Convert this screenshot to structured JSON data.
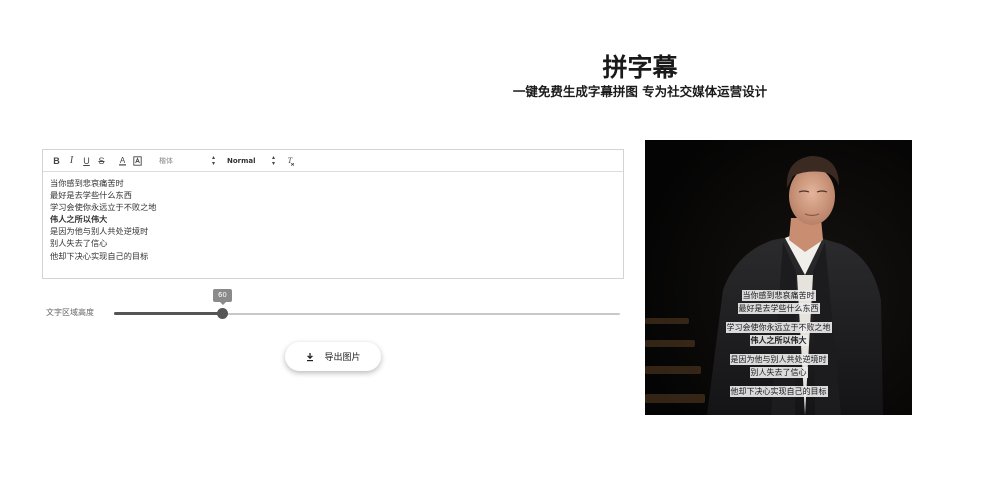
{
  "header": {
    "title": "拼字幕",
    "subtitle": "一键免费生成字幕拼图 专为社交媒体运营设计"
  },
  "editor": {
    "toolbar": {
      "bold": "B",
      "italic": "I",
      "underline": "U",
      "strike": "S",
      "text_color": "A",
      "font_value": "楷体",
      "size_value": "Normal",
      "clear_format": "T"
    },
    "lines": [
      {
        "text": "当你感到悲哀痛苦时",
        "bold": false
      },
      {
        "text": "最好是去学些什么东西",
        "bold": false
      },
      {
        "text": "学习会使你永远立于不败之地",
        "bold": false
      },
      {
        "text": "伟人之所以伟大",
        "bold": true
      },
      {
        "text": "是因为他与别人共处逆境时",
        "bold": false
      },
      {
        "text": "别人失去了信心",
        "bold": false
      },
      {
        "text": "他却下决心实现自己的目标",
        "bold": false
      }
    ]
  },
  "slider": {
    "label": "文字区域高度",
    "value": 60,
    "value_text": "60",
    "min": 0,
    "max": 280
  },
  "export_button": {
    "label": "导出图片",
    "icon": "download-icon"
  },
  "preview": {
    "captions": [
      {
        "text": "当你感到悲哀痛苦时",
        "bold": false
      },
      {
        "text": "最好是去学些什么东西",
        "bold": false
      },
      {
        "gap": true
      },
      {
        "text": "学习会使你永远立于不败之地",
        "bold": false
      },
      {
        "text": "伟人之所以伟大",
        "bold": true
      },
      {
        "gap": true
      },
      {
        "text": "是因为他与别人共处逆境时",
        "bold": false
      },
      {
        "text": "别人失去了信心",
        "bold": false
      },
      {
        "gap": true
      },
      {
        "text": "他却下决心实现自己的目标",
        "bold": false
      }
    ]
  },
  "colors": {
    "slider_active": "#555555",
    "slider_rail": "#c8c8c8",
    "tooltip_bg": "#8a8a8a",
    "caption_bg": "#ececec",
    "photo_bg": "#060606"
  }
}
